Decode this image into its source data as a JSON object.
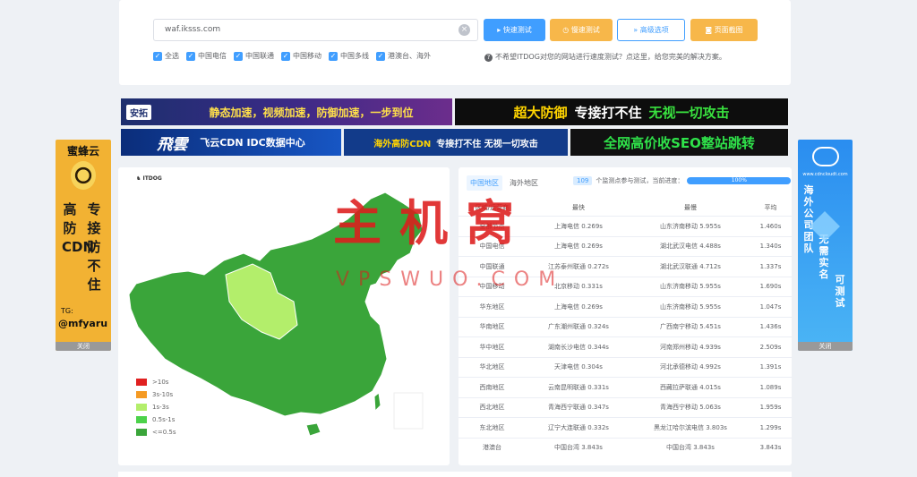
{
  "search": {
    "value": "waf.iksss.com"
  },
  "buttons": {
    "fast": "快速测试",
    "slow": "慢速测试",
    "advanced": "高级选项",
    "screenshot": "页面截图"
  },
  "checks": [
    {
      "label": "全选"
    },
    {
      "label": "中国电信"
    },
    {
      "label": "中国联通"
    },
    {
      "label": "中国移动"
    },
    {
      "label": "中国多线"
    },
    {
      "label": "港澳台、海外"
    }
  ],
  "hint": "不希望ITDOG对您的网站进行速度测试？点这里，给您完美的解决方案。",
  "ads": {
    "ad1_logo": "安拓",
    "ad1_text": "静态加速，视频加速，防御加速，一步到位",
    "ad2_a": "超大防御",
    "ad2_b": "专接打不住",
    "ad2_c": "无视一切攻击",
    "ad3_logo": "飛雲",
    "ad3_text": "飞云CDN IDC数据中心",
    "ad4_a": "海外高防CDN",
    "ad4_b": "专接打不住 无视一切攻击",
    "ad5_text": "全网高价收SEO整站跳转"
  },
  "side_left": {
    "title": "蜜蜂云",
    "col_a": "高防CDN",
    "col_b": "专接防不住",
    "tg": "TG:",
    "handle": "@mfyaru",
    "close": "关闭"
  },
  "side_right": {
    "domain": "www.cdncloudt.com",
    "col_a": "海外公司团队",
    "col_b": "无需实名",
    "col_c": "可测试",
    "close": "关闭"
  },
  "map": {
    "brand": "ITDOG",
    "legend": [
      {
        "label": ">10s",
        "color": "#e02020"
      },
      {
        "label": "3s-10s",
        "color": "#f59a23"
      },
      {
        "label": "1s-3s",
        "color": "#b3ee6b"
      },
      {
        "label": "0.5s-1s",
        "color": "#4cd24a"
      },
      {
        "label": "<=0.5s",
        "color": "#3aa53a"
      }
    ],
    "colors": {
      "main": "#3aa53a",
      "light": "#b3ee6b"
    }
  },
  "table": {
    "tab_china": "中国地区",
    "tab_overseas": "海外地区",
    "count": "109",
    "progress_label": "个监测点参与测试，当前进度：",
    "progress": "100%",
    "headers": [
      "区域/运营商",
      "最快",
      "最慢",
      "平均"
    ],
    "rows": [
      [
        "全部节点",
        "上海电信 0.269s",
        "山东济南移动 5.955s",
        "1.460s"
      ],
      [
        "中国电信",
        "上海电信 0.269s",
        "湖北武汉电信 4.488s",
        "1.340s"
      ],
      [
        "中国联通",
        "江苏泰州联通 0.272s",
        "湖北武汉联通 4.712s",
        "1.337s"
      ],
      [
        "中国移动",
        "北京移动 0.331s",
        "山东济南移动 5.955s",
        "1.690s"
      ],
      [
        "华东地区",
        "上海电信 0.269s",
        "山东济南移动 5.955s",
        "1.047s"
      ],
      [
        "华南地区",
        "广东潮州联通 0.324s",
        "广西南宁移动 5.451s",
        "1.436s"
      ],
      [
        "华中地区",
        "湖南长沙电信 0.344s",
        "河南郑州移动 4.939s",
        "2.509s"
      ],
      [
        "华北地区",
        "天津电信 0.304s",
        "河北承德移动 4.992s",
        "1.391s"
      ],
      [
        "西南地区",
        "云南昆明联通 0.331s",
        "西藏拉萨联通 4.015s",
        "1.089s"
      ],
      [
        "西北地区",
        "青海西宁联通 0.347s",
        "青海西宁移动 5.063s",
        "1.959s"
      ],
      [
        "东北地区",
        "辽宁大连联通 0.332s",
        "黑龙江哈尔滨电信 3.803s",
        "1.299s"
      ],
      [
        "港澳台",
        "中国台湾 3.843s",
        "中国台湾 3.843s",
        "3.843s"
      ]
    ]
  },
  "watermark": {
    "main": "主机窝",
    "sub": "VPSWUO.COM"
  }
}
